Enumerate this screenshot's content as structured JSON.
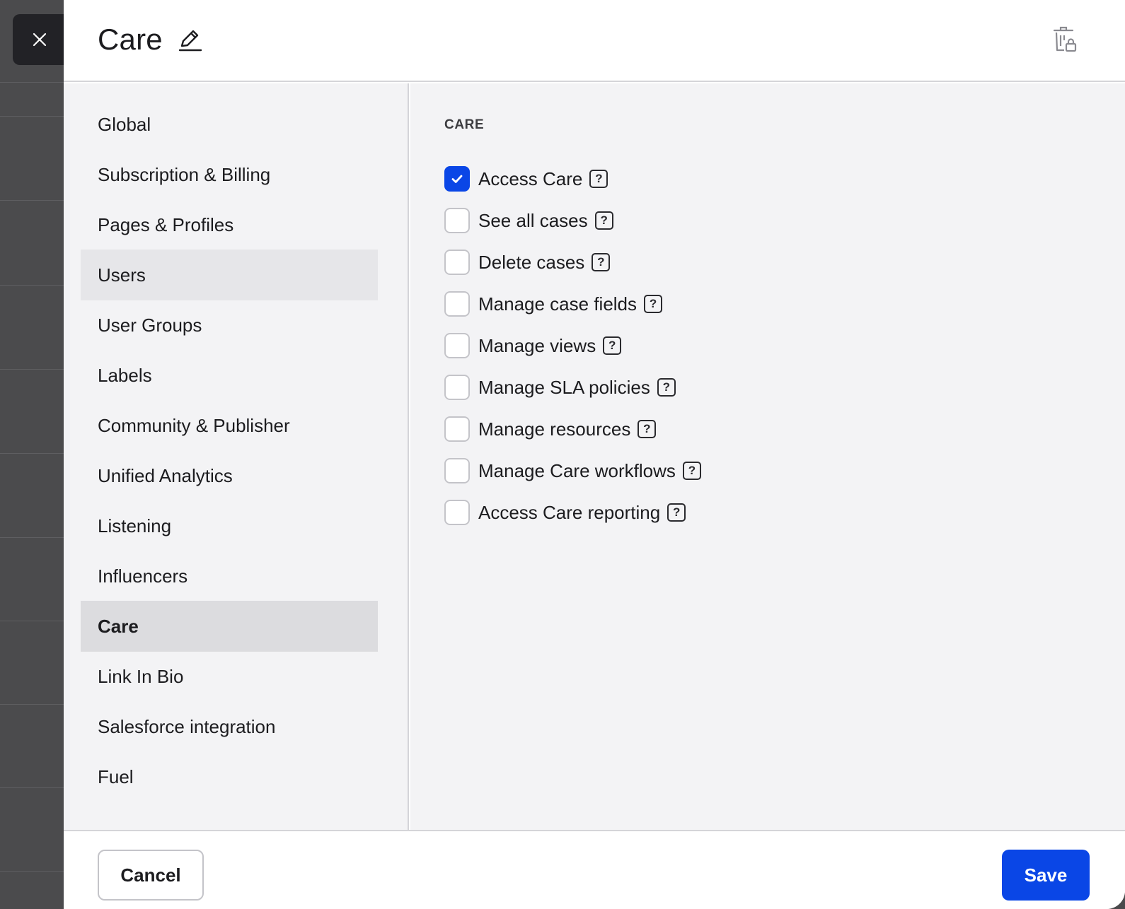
{
  "header": {
    "title": "Care",
    "edit_icon": "pencil-icon",
    "delete_icon": "trash-lock-icon"
  },
  "close_icon": "close-icon",
  "nav": {
    "items": [
      {
        "label": "Global",
        "state": "default"
      },
      {
        "label": "Subscription & Billing",
        "state": "default"
      },
      {
        "label": "Pages & Profiles",
        "state": "default"
      },
      {
        "label": "Users",
        "state": "hover"
      },
      {
        "label": "User Groups",
        "state": "default"
      },
      {
        "label": "Labels",
        "state": "default"
      },
      {
        "label": "Community & Publisher",
        "state": "default"
      },
      {
        "label": "Unified Analytics",
        "state": "default"
      },
      {
        "label": "Listening",
        "state": "default"
      },
      {
        "label": "Influencers",
        "state": "default"
      },
      {
        "label": "Care",
        "state": "active"
      },
      {
        "label": "Link In Bio",
        "state": "default"
      },
      {
        "label": "Salesforce integration",
        "state": "default"
      },
      {
        "label": "Fuel",
        "state": "default"
      }
    ]
  },
  "content": {
    "section_label": "CARE",
    "permissions": [
      {
        "label": "Access Care",
        "checked": true
      },
      {
        "label": "See all cases",
        "checked": false
      },
      {
        "label": "Delete cases",
        "checked": false
      },
      {
        "label": "Manage case fields",
        "checked": false
      },
      {
        "label": "Manage views",
        "checked": false
      },
      {
        "label": "Manage SLA policies",
        "checked": false
      },
      {
        "label": "Manage resources",
        "checked": false
      },
      {
        "label": "Manage Care workflows",
        "checked": false
      },
      {
        "label": "Access Care reporting",
        "checked": false
      }
    ],
    "help_glyph": "?"
  },
  "footer": {
    "cancel_label": "Cancel",
    "save_label": "Save"
  },
  "colors": {
    "accent": "#0a46e6",
    "nav_active": "#dcdcdf",
    "nav_hover": "#e6e6e9",
    "panel_bg": "#f3f3f5"
  }
}
